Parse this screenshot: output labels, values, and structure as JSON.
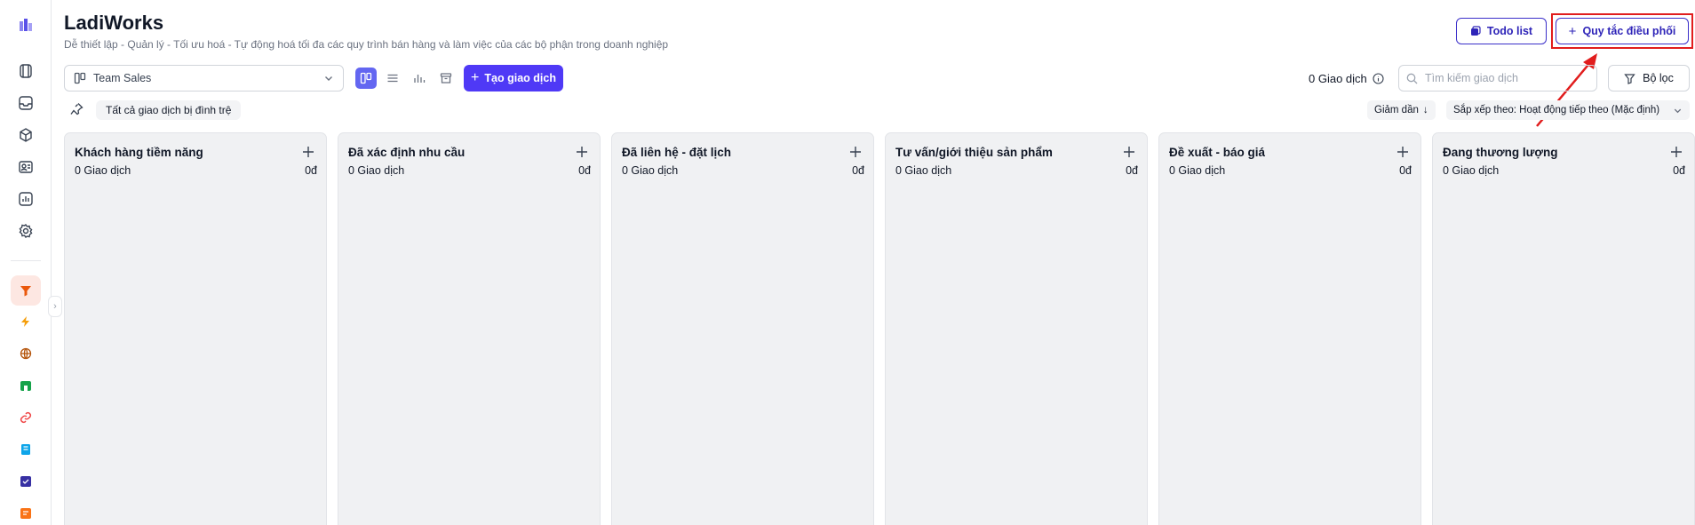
{
  "app": {
    "title": "LadiWorks",
    "subtitle": "Dễ thiết lập - Quản lý - Tối ưu hoá - Tự động hoá tối đa các quy trình bán hàng và làm việc của các bộ phận trong doanh nghiệp"
  },
  "header": {
    "todo_label": "Todo list",
    "quy_tac_label": "Quy tắc điều phối"
  },
  "toolbar": {
    "team_select": "Team Sales",
    "create_label": "Tạo giao dịch",
    "deal_count": "0 Giao dịch",
    "search_placeholder": "Tìm kiếm giao dịch",
    "filter_label": "Bộ lọc"
  },
  "row2": {
    "stale_chip": "Tất cả giao dịch bị đình trệ",
    "sort_direction": "Giảm dần",
    "sort_by": "Sắp xếp theo: Hoạt động tiếp theo (Mặc định)"
  },
  "sidebar": {
    "icons": [
      "logo-icon",
      "projects-icon",
      "inbox-icon",
      "box-icon",
      "contacts-icon",
      "report-icon",
      "settings-icon",
      "funnel-icon",
      "lightning-icon",
      "globe-icon",
      "store-icon",
      "link-icon",
      "book-icon",
      "form-icon",
      "pages-icon"
    ]
  },
  "columns": [
    {
      "title": "Khách hàng tiềm năng",
      "count": "0 Giao dịch",
      "amount": "0đ"
    },
    {
      "title": "Đã xác định nhu cầu",
      "count": "0 Giao dịch",
      "amount": "0đ"
    },
    {
      "title": "Đã liên hệ - đặt lịch",
      "count": "0 Giao dịch",
      "amount": "0đ"
    },
    {
      "title": "Tư vấn/giới thiệu sản phẩm",
      "count": "0 Giao dịch",
      "amount": "0đ"
    },
    {
      "title": "Đề xuất - báo giá",
      "count": "0 Giao dịch",
      "amount": "0đ"
    },
    {
      "title": "Đang thương lượng",
      "count": "0 Giao dịch",
      "amount": "0đ"
    }
  ],
  "colors": {
    "primary": "#4f39f6",
    "highlight": "#e11d1d",
    "column_bg": "#f0f1f3"
  }
}
